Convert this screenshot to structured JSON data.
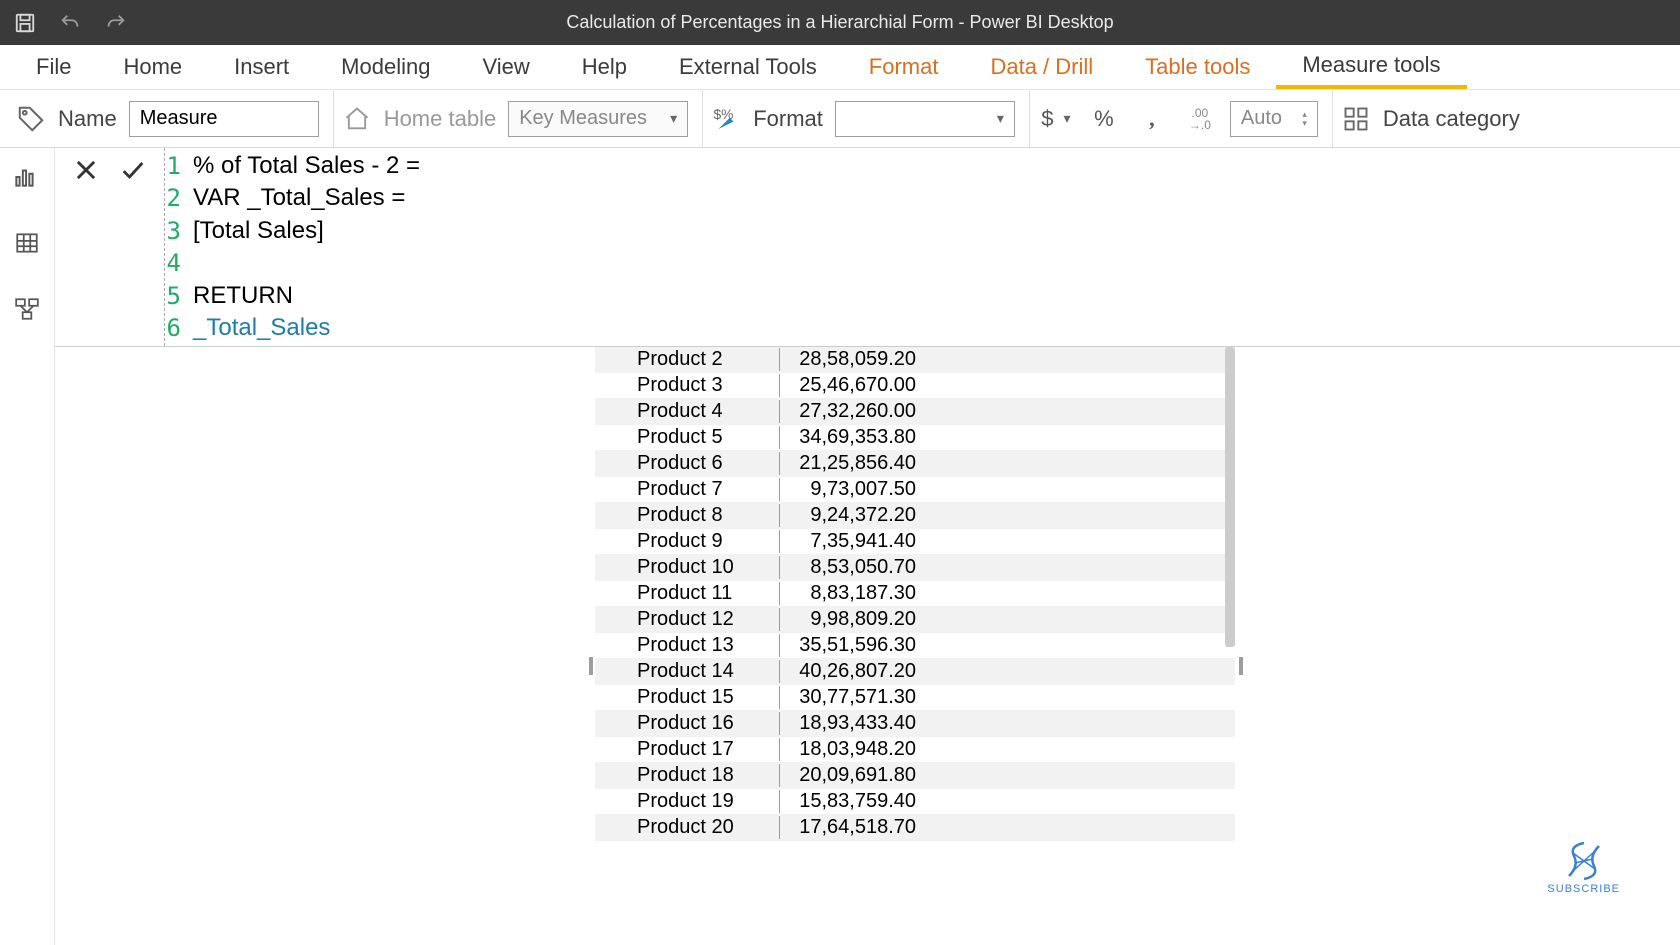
{
  "titlebar": {
    "title": "Calculation of Percentages in a Hierarchial Form - Power BI Desktop"
  },
  "ribbon": {
    "tabs": {
      "file": "File",
      "home": "Home",
      "insert": "Insert",
      "modeling": "Modeling",
      "view": "View",
      "help": "Help",
      "external": "External Tools",
      "format": "Format",
      "datadrill": "Data / Drill",
      "tabletools": "Table tools",
      "measuretools": "Measure tools"
    },
    "nameLabel": "Name",
    "nameValue": "Measure",
    "homeTableLabel": "Home table",
    "homeTableValue": "Key Measures",
    "formatLabel": "Format",
    "currency": "$",
    "percent": "%",
    "comma": ",",
    "decimalShift": ".00 →.0",
    "autoValue": "Auto",
    "dataCategoryLabel": "Data category"
  },
  "formula": {
    "lines": [
      {
        "n": "1",
        "code": "% of Total Sales - 2 = "
      },
      {
        "n": "2",
        "code": "VAR _Total_Sales = "
      },
      {
        "n": "3",
        "code": "[Total Sales]"
      },
      {
        "n": "4",
        "code": ""
      },
      {
        "n": "5",
        "code": "RETURN"
      },
      {
        "n": "6",
        "code": "_Total_Sales",
        "ref": true
      }
    ]
  },
  "table": {
    "rows": [
      {
        "p": "Product 2",
        "v": "28,58,059.20"
      },
      {
        "p": "Product 3",
        "v": "25,46,670.00"
      },
      {
        "p": "Product 4",
        "v": "27,32,260.00"
      },
      {
        "p": "Product 5",
        "v": "34,69,353.80"
      },
      {
        "p": "Product 6",
        "v": "21,25,856.40"
      },
      {
        "p": "Product 7",
        "v": "9,73,007.50"
      },
      {
        "p": "Product 8",
        "v": "9,24,372.20"
      },
      {
        "p": "Product 9",
        "v": "7,35,941.40"
      },
      {
        "p": "Product 10",
        "v": "8,53,050.70"
      },
      {
        "p": "Product 11",
        "v": "8,83,187.30"
      },
      {
        "p": "Product 12",
        "v": "9,98,809.20"
      },
      {
        "p": "Product 13",
        "v": "35,51,596.30"
      },
      {
        "p": "Product 14",
        "v": "40,26,807.20"
      },
      {
        "p": "Product 15",
        "v": "30,77,571.30"
      },
      {
        "p": "Product 16",
        "v": "18,93,433.40"
      },
      {
        "p": "Product 17",
        "v": "18,03,948.20"
      },
      {
        "p": "Product 18",
        "v": "20,09,691.80"
      },
      {
        "p": "Product 19",
        "v": "15,83,759.40"
      },
      {
        "p": "Product 20",
        "v": "17,64,518.70"
      }
    ]
  },
  "subscribe": {
    "label": "SUBSCRIBE"
  }
}
